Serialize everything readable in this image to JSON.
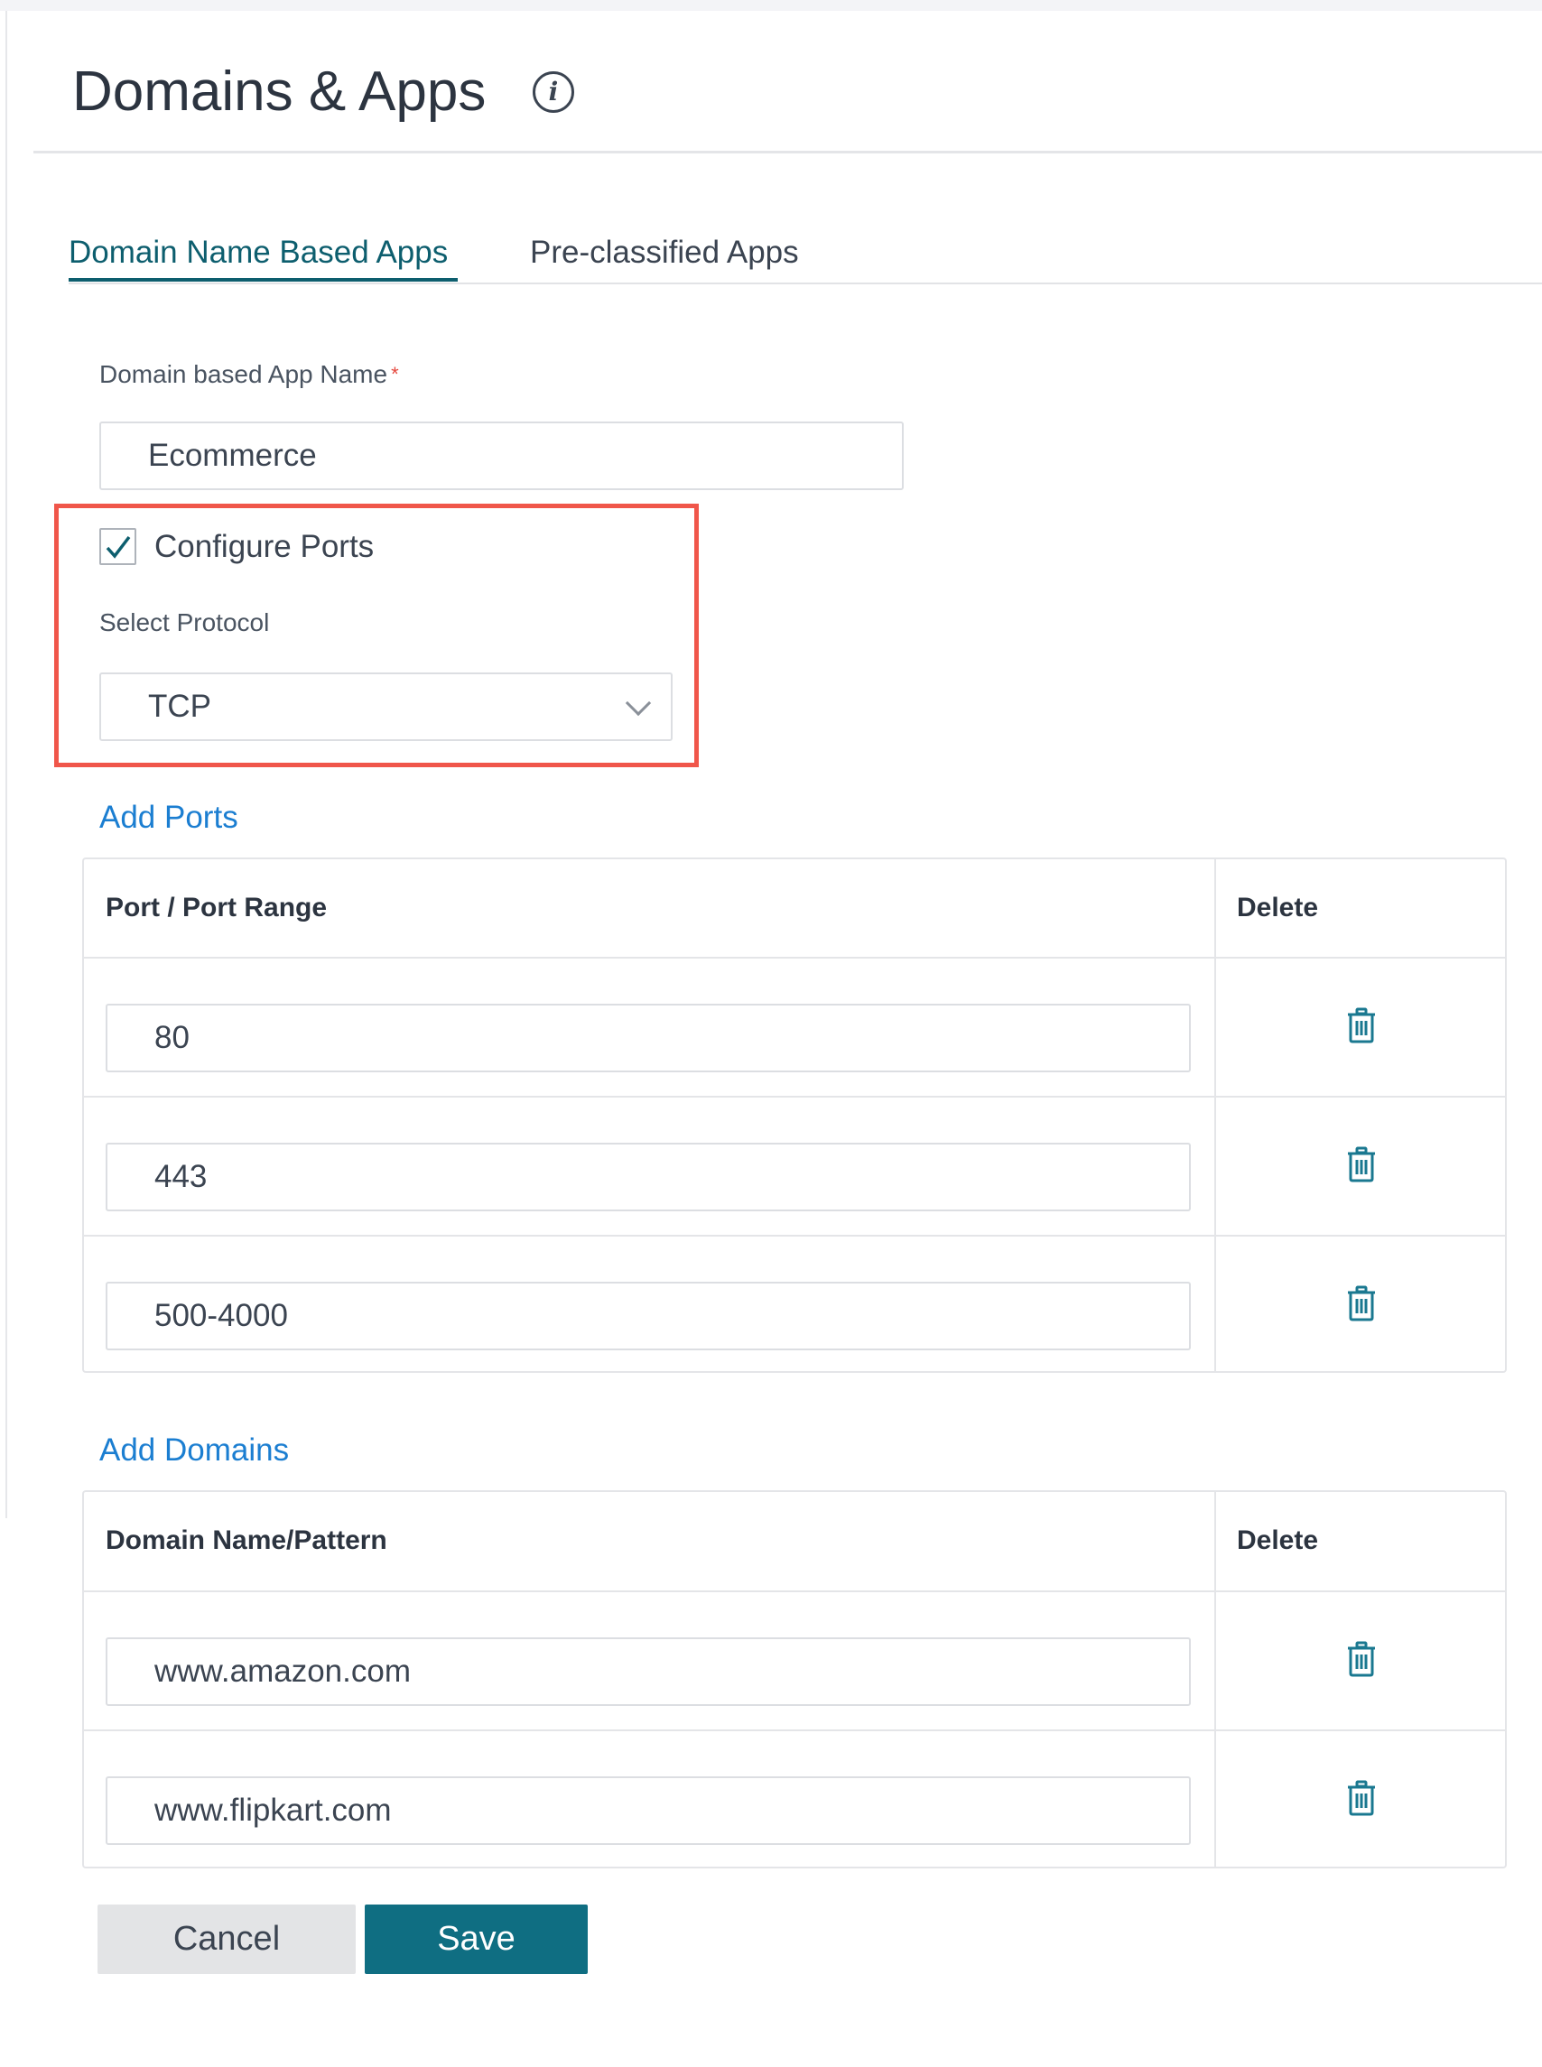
{
  "header": {
    "title": "Domains & Apps",
    "info_icon": "info-icon"
  },
  "tabs": [
    {
      "label": "Domain Name Based Apps",
      "active": true
    },
    {
      "label": "Pre-classified Apps",
      "active": false
    }
  ],
  "form": {
    "app_name_label": "Domain based App Name",
    "required_marker": "*",
    "app_name_value": "Ecommerce",
    "configure_ports_label": "Configure Ports",
    "configure_ports_checked": true,
    "protocol_label": "Select Protocol",
    "protocol_value": "TCP"
  },
  "ports": {
    "add_label": "Add Ports",
    "col_port": "Port / Port Range",
    "col_delete": "Delete",
    "rows": [
      "80",
      "443",
      "500-4000"
    ]
  },
  "domains": {
    "add_label": "Add Domains",
    "col_domain": "Domain Name/Pattern",
    "col_delete": "Delete",
    "rows": [
      "www.amazon.com",
      "www.flipkart.com"
    ]
  },
  "buttons": {
    "cancel": "Cancel",
    "save": "Save"
  },
  "colors": {
    "accent": "#0d5e6e",
    "link": "#1b7ed1",
    "highlight": "#f0564a",
    "save": "#0f6e82",
    "trash": "#1a7890"
  }
}
